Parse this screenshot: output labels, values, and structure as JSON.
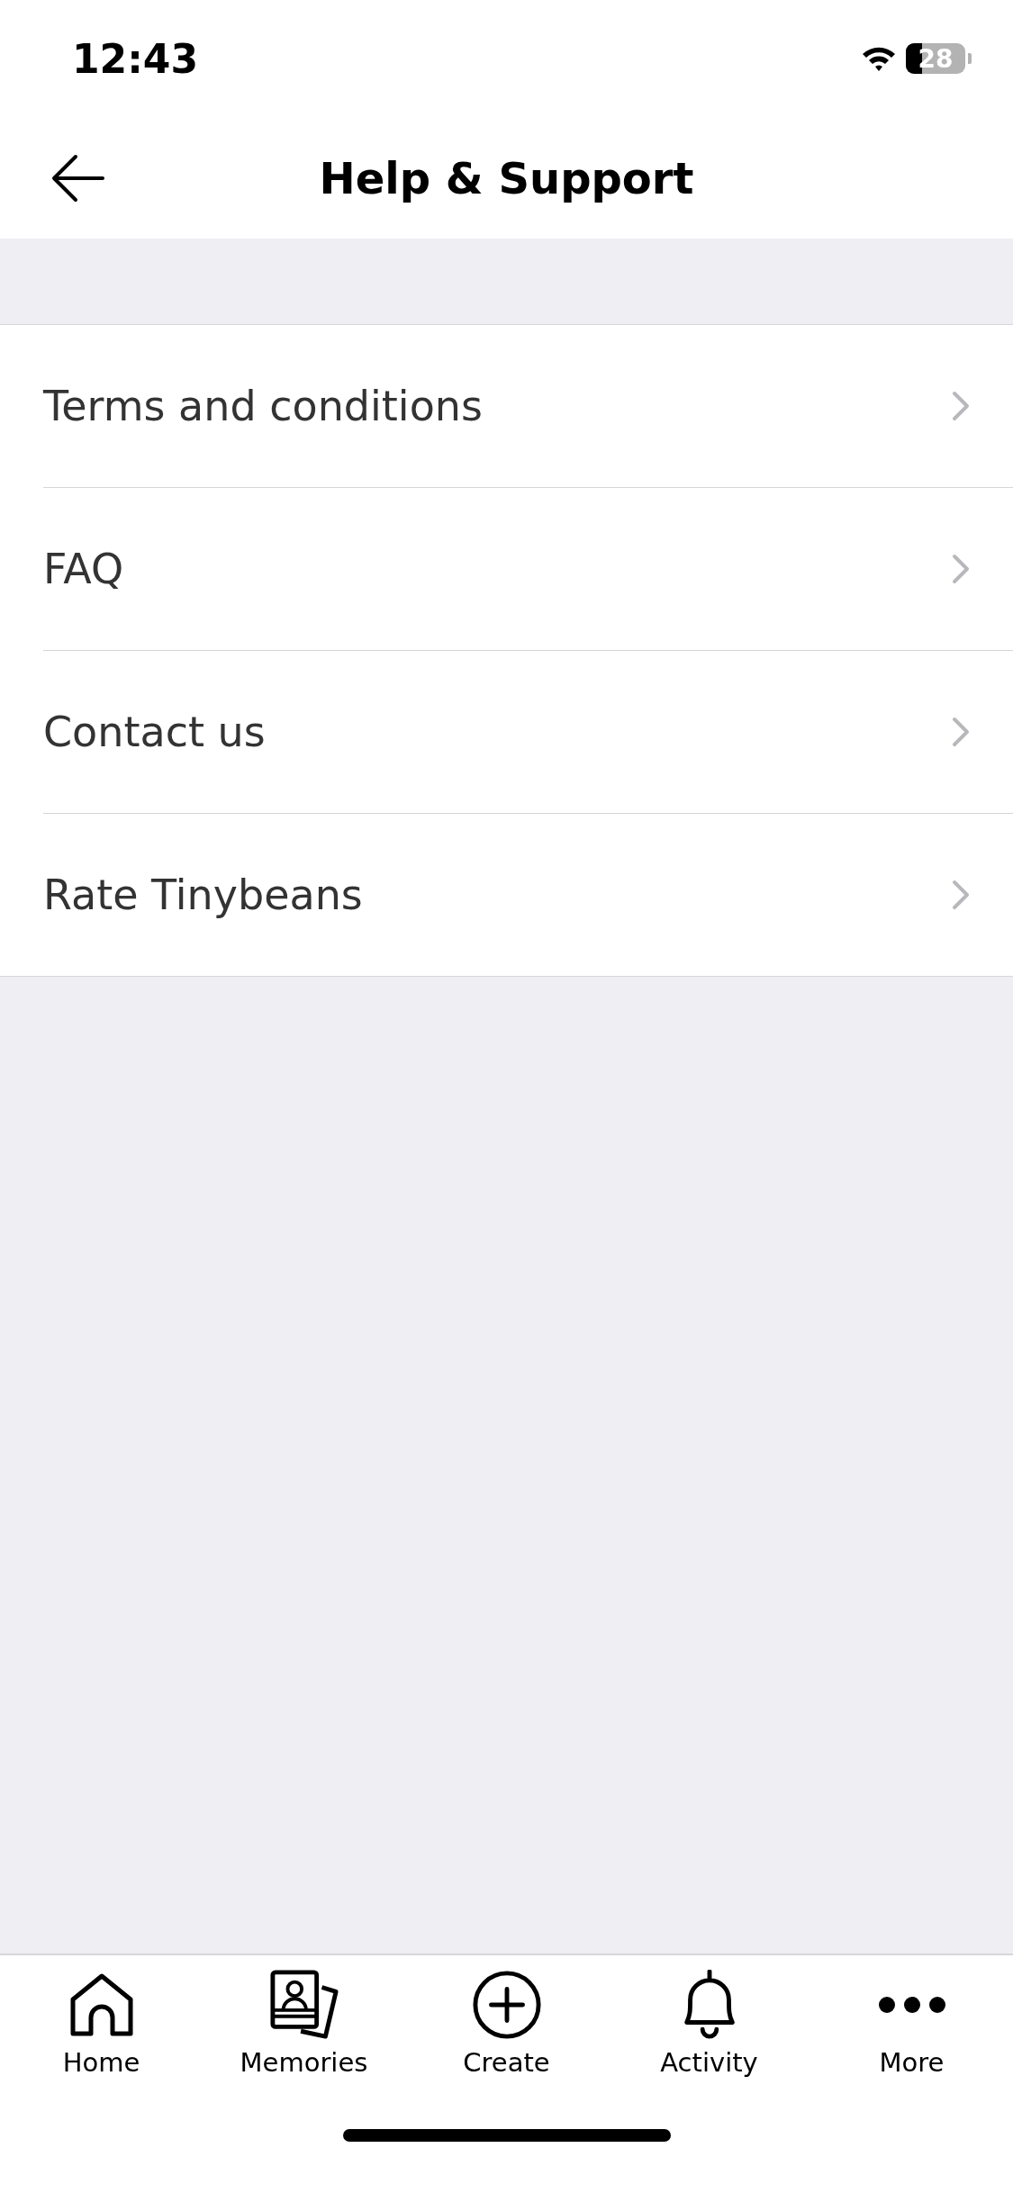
{
  "status_bar": {
    "time": "12:43",
    "battery": "28"
  },
  "nav_bar": {
    "title": "Help & Support"
  },
  "menu_items": [
    {
      "label": "Terms and conditions"
    },
    {
      "label": "FAQ"
    },
    {
      "label": "Contact us"
    },
    {
      "label": "Rate Tinybeans"
    }
  ],
  "tab_bar": [
    {
      "label": "Home",
      "kind": "home"
    },
    {
      "label": "Memories",
      "kind": "memories"
    },
    {
      "label": "Create",
      "kind": "create"
    },
    {
      "label": "Activity",
      "kind": "activity"
    },
    {
      "label": "More",
      "kind": "more"
    }
  ]
}
